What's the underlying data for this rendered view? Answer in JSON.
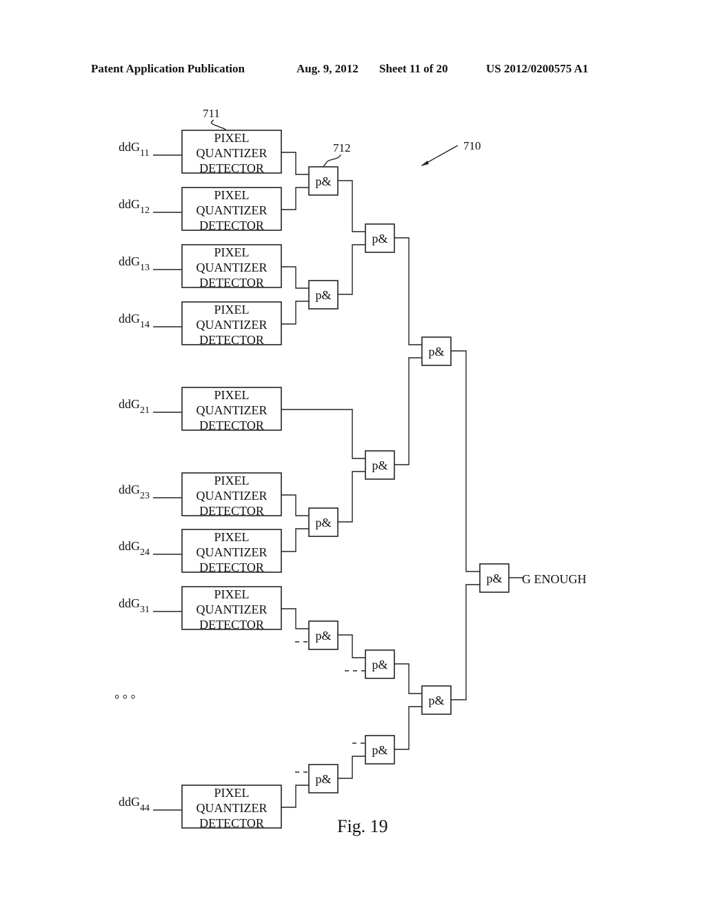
{
  "header": {
    "publication": "Patent Application Publication",
    "date": "Aug. 9, 2012",
    "sheet": "Sheet 11 of 20",
    "number": "US 2012/0200575 A1"
  },
  "figure": {
    "caption": "Fig. 19",
    "ref_system": "710",
    "ref_detector": "711",
    "ref_gate": "712",
    "detector_lines": [
      "PIXEL",
      "QUANTIZER",
      "DETECTOR"
    ],
    "gate_label": "p&",
    "output_label": "G ENOUGH",
    "ellipsis": "°  °  °",
    "inputs": [
      {
        "prefix": "ddG",
        "sub": "11"
      },
      {
        "prefix": "ddG",
        "sub": "12"
      },
      {
        "prefix": "ddG",
        "sub": "13"
      },
      {
        "prefix": "ddG",
        "sub": "14"
      },
      {
        "prefix": "ddG",
        "sub": "21"
      },
      {
        "prefix": "ddG",
        "sub": "23"
      },
      {
        "prefix": "ddG",
        "sub": "24"
      },
      {
        "prefix": "ddG",
        "sub": "31"
      },
      {
        "prefix": "ddG",
        "sub": "44"
      }
    ]
  }
}
